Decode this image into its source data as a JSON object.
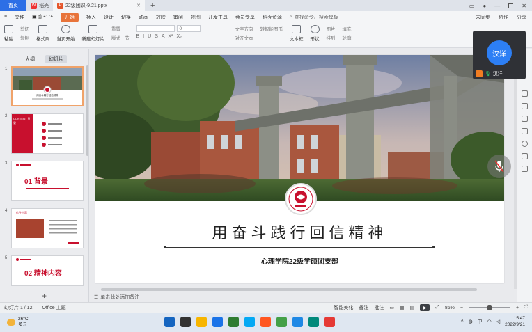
{
  "titlebar": {
    "home_tab": "首页",
    "tabs": [
      {
        "label": "稻壳",
        "icon": "docer-icon"
      },
      {
        "label": "22级团课-9.21.pptx",
        "icon": "ppt-file-icon"
      }
    ],
    "new_tab": "+"
  },
  "menubar": {
    "file": "文件",
    "items": [
      "开始",
      "插入",
      "设计",
      "切换",
      "动画",
      "放映",
      "审阅",
      "视图",
      "开发工具",
      "会员专享",
      "稻壳资源"
    ],
    "search_placeholder": "查找命令、搜索模板",
    "right": [
      "未同步",
      "协作",
      "分享"
    ]
  },
  "ribbon": {
    "paste": "粘贴",
    "cut": "剪切",
    "copy": "复制",
    "format_painter": "格式刷",
    "from_current": "当页开始",
    "new_slide": "新建幻灯片",
    "layout": "版式",
    "section": "节",
    "reset": "重置",
    "font_size": "0",
    "format_buttons": [
      "B",
      "I",
      "U",
      "S",
      "A",
      "X²",
      "X₂"
    ],
    "convert_to_smartart": "转智能图形",
    "text_box": "文本框",
    "shape": "形状",
    "arrange": "排列",
    "image": "图片",
    "fill": "填充",
    "outline": "轮廓",
    "text_direction": "文字方向",
    "align_text": "对齐文本"
  },
  "left_panel": {
    "tabs": [
      "大纲",
      "幻灯片"
    ],
    "active_tab": "幻灯片",
    "thumbnails": [
      {
        "num": "1",
        "label": "用奋斗践行回信精神",
        "selected": true
      },
      {
        "num": "2",
        "label": "CONTENT 目录",
        "selected": false
      },
      {
        "num": "3",
        "label": "01 背景",
        "selected": false
      },
      {
        "num": "4",
        "label": "信件内容",
        "selected": false
      },
      {
        "num": "5",
        "label": "02 精神内容",
        "selected": false
      }
    ],
    "add": "+"
  },
  "slide": {
    "title": "用奋斗践行回信精神",
    "subtitle": "心理学院22级学硕团支部"
  },
  "notes_placeholder": "单击此处添加备注",
  "overlay": {
    "avatar_initials": "汉洋",
    "participant_name": "汉洋"
  },
  "statusbar": {
    "slide_counter": "幻灯片 1 / 12",
    "theme": "Office 主题",
    "smart_beautify": "智能美化",
    "notes": "备注",
    "comments": "批注",
    "zoom": "86%",
    "zoom_level": 0.5
  },
  "taskbar": {
    "temperature": "26°C",
    "weather": "多云",
    "time": "15:47",
    "date": "2022/9/21",
    "ime": "中",
    "app_colors": [
      "#1565c0",
      "#333333",
      "#f7b500",
      "#1a73e8",
      "#2e7d32",
      "#03a9f4",
      "#ff5722",
      "#43a047",
      "#1e88e5",
      "#00897b",
      "#e53935"
    ]
  },
  "colors": {
    "accent_blue": "#2d6fe6",
    "start_orange": "#e8743b",
    "selected_border": "#f0a36a",
    "slide_red": "#c8102e"
  }
}
